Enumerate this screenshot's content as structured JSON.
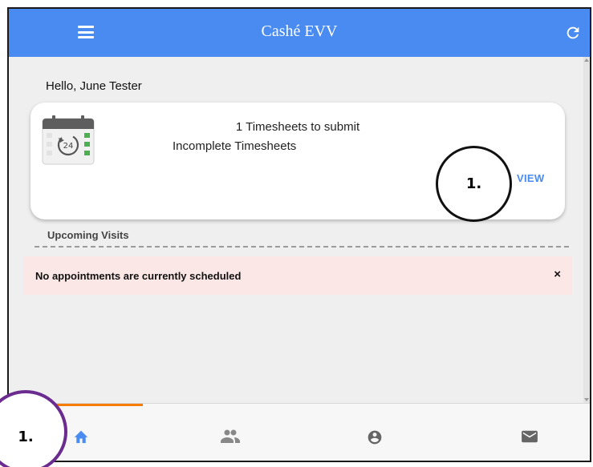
{
  "header": {
    "title": "Cashé EVV",
    "menu_icon": "menu-icon",
    "refresh_icon": "refresh-icon",
    "color": "#4a8bf2"
  },
  "greeting": "Hello, June Tester",
  "timesheet_card": {
    "icon": "calendar-24-icon",
    "line1": "1 Timesheets to submit",
    "line2": "Incomplete Timesheets",
    "action": "VIEW",
    "calendar_day": "24"
  },
  "upcoming": {
    "label": "Upcoming Visits"
  },
  "alert": {
    "message": "No appointments are currently scheduled",
    "close": "×",
    "background": "#fbe7e5"
  },
  "bottom_nav": {
    "active_color": "#f57c00",
    "tabs": [
      {
        "icon": "home-icon",
        "active": true
      },
      {
        "icon": "people-icon",
        "active": false
      },
      {
        "icon": "account-circle-icon",
        "active": false
      },
      {
        "icon": "mail-icon",
        "active": false
      }
    ]
  },
  "annotations": [
    {
      "label": "1."
    },
    {
      "label": "1."
    }
  ]
}
